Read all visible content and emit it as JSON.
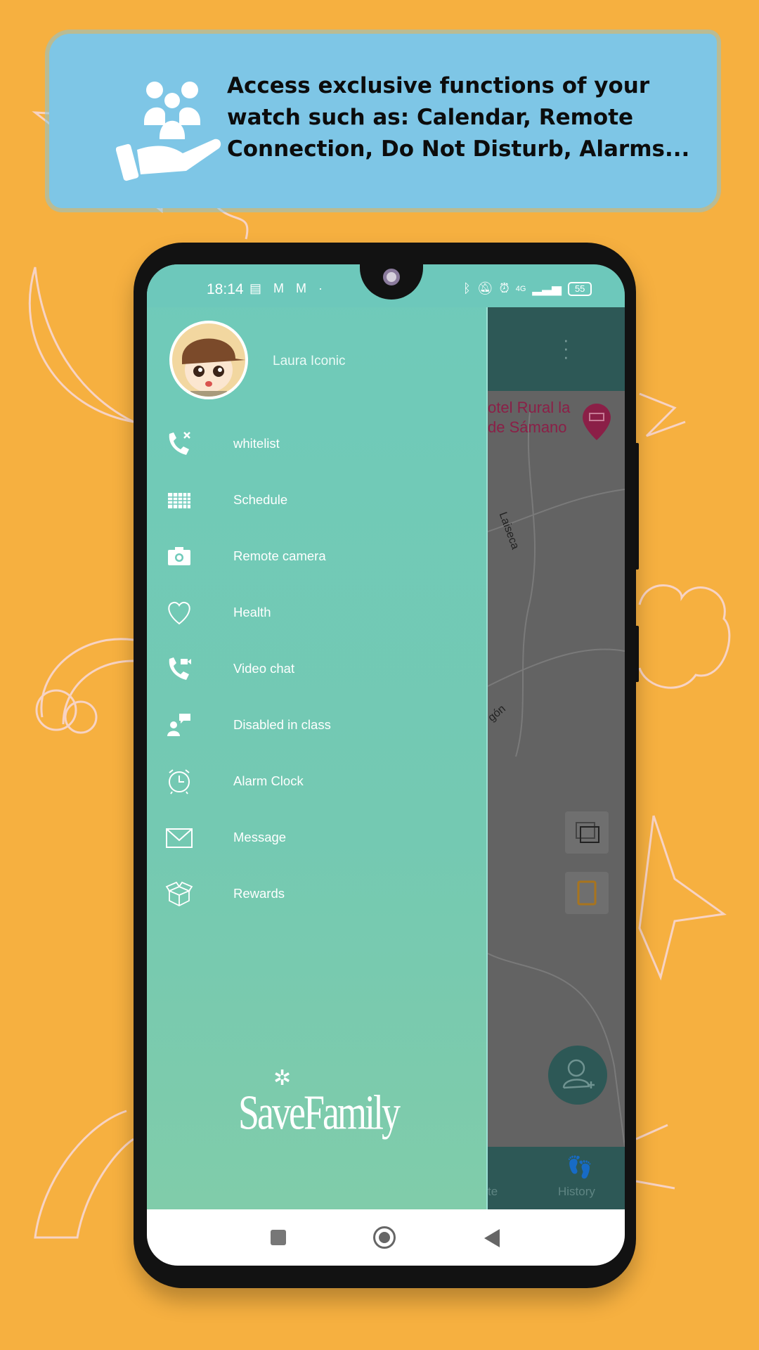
{
  "banner": {
    "line_plain": "Access exclusive functions of your watch such as: ",
    "line_bold": "Calendar, Remote Connection, Do Not Disturb, Alarms...",
    "icon": "family-care-hand-icon"
  },
  "status_bar": {
    "time": "18:14",
    "left_icons": [
      "notification-icon",
      "gmail-icon",
      "gmail-icon",
      "dot"
    ],
    "network": "4G",
    "battery": "55"
  },
  "drawer": {
    "user_name": "Laura Iconic",
    "items": [
      {
        "label": "whitelist",
        "icon": "phone-blocked-icon"
      },
      {
        "label": "Schedule",
        "icon": "calendar-grid-icon"
      },
      {
        "label": "Remote camera",
        "icon": "camera-icon"
      },
      {
        "label": "Health",
        "icon": "heart-icon"
      },
      {
        "label": "Video chat",
        "icon": "video-call-icon"
      },
      {
        "label": "Disabled in class",
        "icon": "class-mode-icon"
      },
      {
        "label": "Alarm Clock",
        "icon": "alarm-clock-icon"
      },
      {
        "label": "Message",
        "icon": "envelope-icon"
      },
      {
        "label": "Rewards",
        "icon": "gift-box-icon"
      }
    ],
    "logo": "SaveFamily"
  },
  "map": {
    "place_line1": "otel Rural la",
    "place_line2": "de Sámano",
    "road1": "Laiseca",
    "road2": "gón"
  },
  "bottom_nav": {
    "partial_label": "te",
    "history_label": "History"
  },
  "colors": {
    "background": "#f6b040",
    "banner": "#7ec6e6",
    "drawer": "#6fcaba",
    "app_primary": "#2d5856",
    "place_text": "#8b1f47"
  }
}
